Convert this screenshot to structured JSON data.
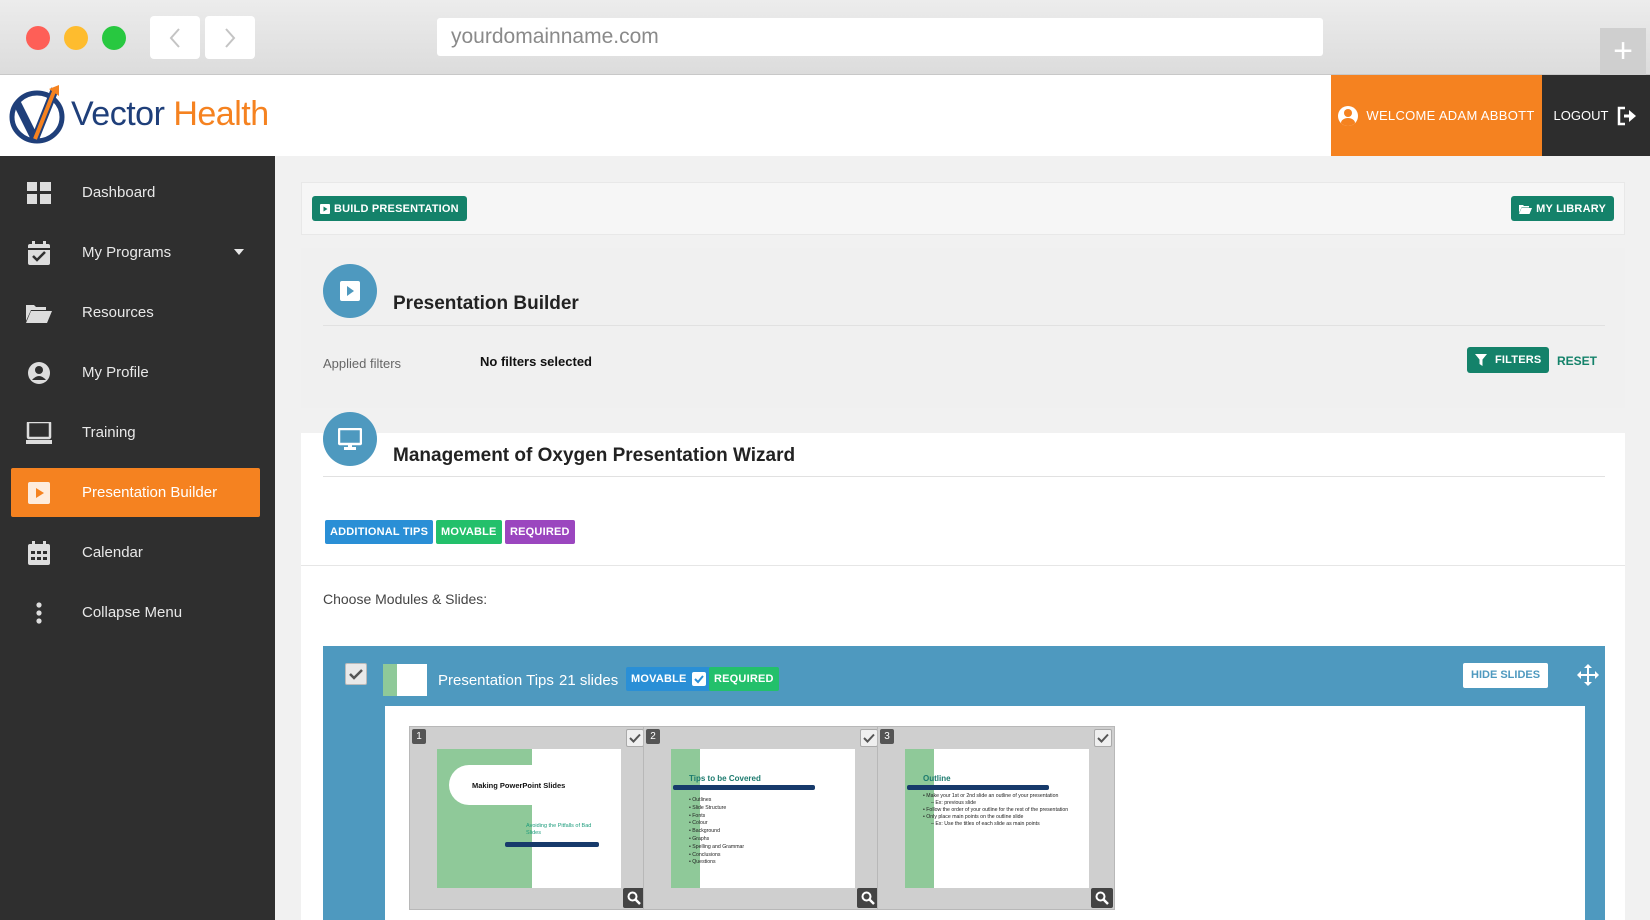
{
  "browser": {
    "url": "yourdomainname.com",
    "new_tab_label": "+"
  },
  "header": {
    "brand_part1": "Vector",
    "brand_part2": "Health",
    "welcome": "WELCOME ADAM ABBOTT",
    "logout": "LOGOUT"
  },
  "sidebar": {
    "items": [
      {
        "label": "Dashboard",
        "icon": "grid-icon"
      },
      {
        "label": "My Programs",
        "icon": "calendar-check-icon"
      },
      {
        "label": "Resources",
        "icon": "folder-open-icon"
      },
      {
        "label": "My Profile",
        "icon": "user-circle-icon"
      },
      {
        "label": "Training",
        "icon": "laptop-icon"
      },
      {
        "label": "Presentation Builder",
        "icon": "play-square-icon"
      },
      {
        "label": "Calendar",
        "icon": "calendar-icon"
      },
      {
        "label": "Collapse Menu",
        "icon": "vertical-dots-icon"
      }
    ]
  },
  "toolbar": {
    "build_label": "BUILD PRESENTATION",
    "library_label": "MY LIBRARY"
  },
  "builder": {
    "title": "Presentation Builder",
    "applied_label": "Applied filters",
    "no_filters": "No filters selected",
    "filters_label": "FILTERS",
    "reset_label": "RESET"
  },
  "wizard": {
    "title": "Management of Oxygen Presentation Wizard",
    "tags": [
      "ADDITIONAL TIPS",
      "MOVABLE",
      "REQUIRED"
    ],
    "choose_label": "Choose Modules & Slides:"
  },
  "module": {
    "name": "Presentation Tips",
    "count": "21 slides",
    "movable_label": "MOVABLE",
    "required_label": "REQUIRED",
    "hide_slides_label": "HIDE SLIDES"
  },
  "slides": [
    {
      "number": "1",
      "title": "Making PowerPoint Slides",
      "subtitle": "Avoiding the Pitfalls of Bad Slides"
    },
    {
      "number": "2",
      "title": "Tips to be Covered",
      "bullets": [
        "Outlines",
        "Slide Structure",
        "Fonts",
        "Colour",
        "Background",
        "Graphs",
        "Spelling and Grammar",
        "Conclusions",
        "Questions"
      ]
    },
    {
      "number": "3",
      "title": "Outline",
      "bullets": [
        "Make your 1st or 2nd slide an outline of your presentation",
        "– Ex: previous slide",
        "Follow the order of your outline for the rest of the presentation",
        "Only place main points on the outline slide",
        "– Ex: Use the titles of each slide as main points"
      ]
    }
  ],
  "colors": {
    "brand_orange": "#f58220",
    "brand_navy": "#1f3f7a",
    "sidebar_bg": "#2f2f2f",
    "action_green": "#14826a",
    "module_blue": "#4e99bf",
    "tag_blue": "#2a8fd6",
    "tag_green": "#23c06b",
    "tag_purple": "#9b46bf"
  }
}
